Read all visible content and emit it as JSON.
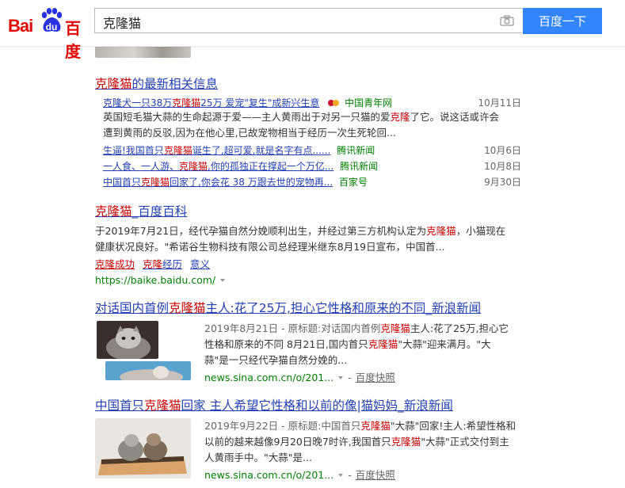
{
  "header": {
    "logo_bai": "Bai",
    "logo_du": "du",
    "logo_cn": "百度",
    "search_value": "克隆猫",
    "search_button": "百度一下"
  },
  "section_news": {
    "title_pre": "克隆猫",
    "title_post": "的最新相关信息",
    "items": [
      {
        "title_a": "克隆犬一只38万",
        "title_b": "克隆猫",
        "title_c": "25万 爱宠\"复生\"成新兴生意",
        "source": "中国青年网",
        "date": "10月11日"
      },
      {
        "title_a": "生逼!我国首只",
        "title_b": "克隆猫",
        "title_c": "诞生了,超可爱,就是名字有点......",
        "source": "腾讯新闻",
        "date": "10月6日"
      },
      {
        "title_a": "一人食、一人游、",
        "title_b": "克隆猫",
        "title_c": ",你的孤独正在撑起一个万亿...",
        "source": "腾讯新闻",
        "date": "10月8日"
      },
      {
        "title_a": "中国首只",
        "title_b": "克隆猫",
        "title_c": "回家了,你会花 38 万跟去世的宠物再...",
        "source": "百家号",
        "date": "9月30日"
      }
    ],
    "abstract_1": "英国短毛猫大蒜的生命起源于爱——主人黄雨出于对另一只猫的爱",
    "abstract_hl": "克隆",
    "abstract_2": "了它。说这话或许会",
    "abstract_line2": "遭到黄雨的反驳,因为在他心里,已故宠物相当于经历一次生死轮回..."
  },
  "result_baike": {
    "title_a": "克隆猫",
    "title_b": "_百度百科",
    "line1_a": "于2019年7月21日，经代孕猫自然分娩顺利出生，并经过第三方机构认定为",
    "line1_hl": "克隆猫",
    "line1_b": "，小猫现在",
    "line2": "健康状况良好。\"希诺谷生物科技有限公司总经理米继东8月19日宣布，中国首...",
    "sublinks": [
      "克隆成功",
      "克隆经历",
      "意义"
    ],
    "url": "https://baike.baidu.com/"
  },
  "result_sina1": {
    "title_a": "对话国内首例",
    "title_hl": "克隆猫",
    "title_b": "主人:花了25万,担心它性格和原来的不同_新浪新闻",
    "l1_a": "2019年8月21日 - 原标题:对话国内首例",
    "l1_hl": "克隆猫",
    "l1_b": "主人:花了25万,担心它",
    "l2_a": "性格和原来的不同 8月21日,国内首只",
    "l2_hl": "克隆猫",
    "l2_b": "\"大蒜\"迎来满月。\"大",
    "l3": "蒜\"是一只经代孕猫自然分娩的...",
    "url": "news.sina.com.cn/o/201...",
    "snapshot": "百度快照"
  },
  "result_sina2": {
    "title_a": "中国首只",
    "title_hl": "克隆猫",
    "title_b": "回家 主人希望它性格和以前的像|猫妈妈_新浪新闻",
    "l1_a": "2019年9月22日 - 原标题:中国首只",
    "l1_hl": "克隆猫",
    "l1_b": "\"大蒜\"回家!主人:希望性格和",
    "l2_a": "以前的越来越像9月20日晚7时许,我国首只",
    "l2_hl": "克隆猫",
    "l2_b": "\"大蒜\"正式交付到主",
    "l3": "人黄雨手中。\"大蒜\"是...",
    "url": "news.sina.com.cn/o/201...",
    "snapshot": "百度快照"
  }
}
